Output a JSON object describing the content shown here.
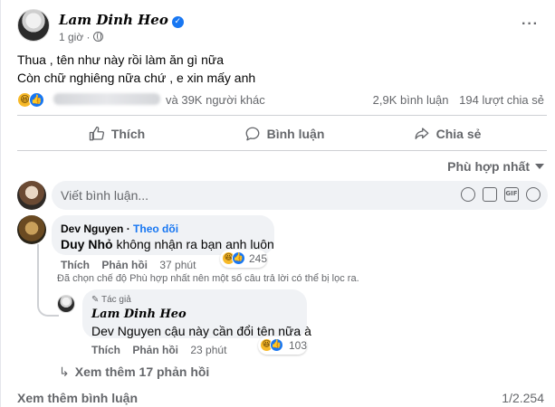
{
  "post": {
    "author": "Lam Dinh Heo",
    "time": "1 giờ ·",
    "text_lines": [
      "Thua , tên như này rồi làm ăn gì nữa",
      "Còn chữ nghiêng nữa chứ , e xin mấy anh"
    ],
    "reactions": {
      "others": "và 39K người khác",
      "comments": "2,9K bình luận",
      "shares": "194 lượt chia sẻ"
    }
  },
  "actions": {
    "like": "Thích",
    "comment": "Bình luận",
    "share": "Chia sẻ"
  },
  "sort_label": "Phù hợp nhất",
  "composer": {
    "placeholder": "Viết bình luận..."
  },
  "comments": [
    {
      "name": "Dev Nguyen",
      "follow": "Theo dõi",
      "mention": "Duy Nhỏ",
      "text": " không nhận ra bạn anh luôn",
      "like": "Thích",
      "reply": "Phản hồi",
      "time": "37 phút",
      "reaction_count": "245"
    }
  ],
  "filter_note": "Đã chọn chế độ Phù hợp nhất nên một số câu trả lời có thể bị lọc ra.",
  "reply": {
    "badge": "Tác giả",
    "name": "Lam Dinh Heo",
    "mention": "Dev Nguyen",
    "text": " cậu này cần đổi tên nữa à",
    "like": "Thích",
    "reply": "Phản hồi",
    "time": "23 phút",
    "reaction_count": "103"
  },
  "more_replies": "Xem thêm 17 phản hồi",
  "more_comments": "Xem thêm bình luận",
  "pager": "1/2.254",
  "colors": {
    "accent": "#1877f2",
    "secondary_text": "#65676b",
    "bubble": "#f0f2f5"
  }
}
